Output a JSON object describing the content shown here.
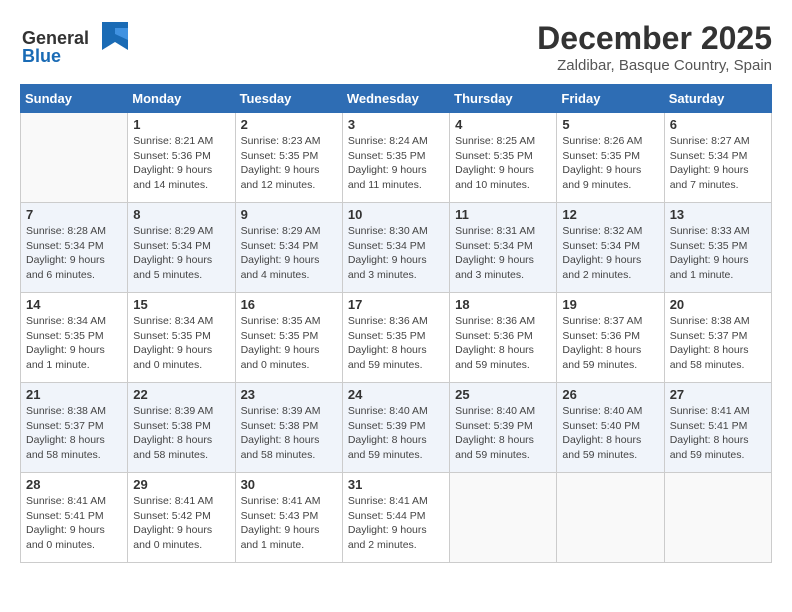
{
  "header": {
    "logo_general": "General",
    "logo_blue": "Blue",
    "month": "December 2025",
    "location": "Zaldibar, Basque Country, Spain"
  },
  "days_of_week": [
    "Sunday",
    "Monday",
    "Tuesday",
    "Wednesday",
    "Thursday",
    "Friday",
    "Saturday"
  ],
  "weeks": [
    [
      {
        "day": "",
        "info": ""
      },
      {
        "day": "1",
        "info": "Sunrise: 8:21 AM\nSunset: 5:36 PM\nDaylight: 9 hours\nand 14 minutes."
      },
      {
        "day": "2",
        "info": "Sunrise: 8:23 AM\nSunset: 5:35 PM\nDaylight: 9 hours\nand 12 minutes."
      },
      {
        "day": "3",
        "info": "Sunrise: 8:24 AM\nSunset: 5:35 PM\nDaylight: 9 hours\nand 11 minutes."
      },
      {
        "day": "4",
        "info": "Sunrise: 8:25 AM\nSunset: 5:35 PM\nDaylight: 9 hours\nand 10 minutes."
      },
      {
        "day": "5",
        "info": "Sunrise: 8:26 AM\nSunset: 5:35 PM\nDaylight: 9 hours\nand 9 minutes."
      },
      {
        "day": "6",
        "info": "Sunrise: 8:27 AM\nSunset: 5:34 PM\nDaylight: 9 hours\nand 7 minutes."
      }
    ],
    [
      {
        "day": "7",
        "info": "Sunrise: 8:28 AM\nSunset: 5:34 PM\nDaylight: 9 hours\nand 6 minutes."
      },
      {
        "day": "8",
        "info": "Sunrise: 8:29 AM\nSunset: 5:34 PM\nDaylight: 9 hours\nand 5 minutes."
      },
      {
        "day": "9",
        "info": "Sunrise: 8:29 AM\nSunset: 5:34 PM\nDaylight: 9 hours\nand 4 minutes."
      },
      {
        "day": "10",
        "info": "Sunrise: 8:30 AM\nSunset: 5:34 PM\nDaylight: 9 hours\nand 3 minutes."
      },
      {
        "day": "11",
        "info": "Sunrise: 8:31 AM\nSunset: 5:34 PM\nDaylight: 9 hours\nand 3 minutes."
      },
      {
        "day": "12",
        "info": "Sunrise: 8:32 AM\nSunset: 5:34 PM\nDaylight: 9 hours\nand 2 minutes."
      },
      {
        "day": "13",
        "info": "Sunrise: 8:33 AM\nSunset: 5:35 PM\nDaylight: 9 hours\nand 1 minute."
      }
    ],
    [
      {
        "day": "14",
        "info": "Sunrise: 8:34 AM\nSunset: 5:35 PM\nDaylight: 9 hours\nand 1 minute."
      },
      {
        "day": "15",
        "info": "Sunrise: 8:34 AM\nSunset: 5:35 PM\nDaylight: 9 hours\nand 0 minutes."
      },
      {
        "day": "16",
        "info": "Sunrise: 8:35 AM\nSunset: 5:35 PM\nDaylight: 9 hours\nand 0 minutes."
      },
      {
        "day": "17",
        "info": "Sunrise: 8:36 AM\nSunset: 5:35 PM\nDaylight: 8 hours\nand 59 minutes."
      },
      {
        "day": "18",
        "info": "Sunrise: 8:36 AM\nSunset: 5:36 PM\nDaylight: 8 hours\nand 59 minutes."
      },
      {
        "day": "19",
        "info": "Sunrise: 8:37 AM\nSunset: 5:36 PM\nDaylight: 8 hours\nand 59 minutes."
      },
      {
        "day": "20",
        "info": "Sunrise: 8:38 AM\nSunset: 5:37 PM\nDaylight: 8 hours\nand 58 minutes."
      }
    ],
    [
      {
        "day": "21",
        "info": "Sunrise: 8:38 AM\nSunset: 5:37 PM\nDaylight: 8 hours\nand 58 minutes."
      },
      {
        "day": "22",
        "info": "Sunrise: 8:39 AM\nSunset: 5:38 PM\nDaylight: 8 hours\nand 58 minutes."
      },
      {
        "day": "23",
        "info": "Sunrise: 8:39 AM\nSunset: 5:38 PM\nDaylight: 8 hours\nand 58 minutes."
      },
      {
        "day": "24",
        "info": "Sunrise: 8:40 AM\nSunset: 5:39 PM\nDaylight: 8 hours\nand 59 minutes."
      },
      {
        "day": "25",
        "info": "Sunrise: 8:40 AM\nSunset: 5:39 PM\nDaylight: 8 hours\nand 59 minutes."
      },
      {
        "day": "26",
        "info": "Sunrise: 8:40 AM\nSunset: 5:40 PM\nDaylight: 8 hours\nand 59 minutes."
      },
      {
        "day": "27",
        "info": "Sunrise: 8:41 AM\nSunset: 5:41 PM\nDaylight: 8 hours\nand 59 minutes."
      }
    ],
    [
      {
        "day": "28",
        "info": "Sunrise: 8:41 AM\nSunset: 5:41 PM\nDaylight: 9 hours\nand 0 minutes."
      },
      {
        "day": "29",
        "info": "Sunrise: 8:41 AM\nSunset: 5:42 PM\nDaylight: 9 hours\nand 0 minutes."
      },
      {
        "day": "30",
        "info": "Sunrise: 8:41 AM\nSunset: 5:43 PM\nDaylight: 9 hours\nand 1 minute."
      },
      {
        "day": "31",
        "info": "Sunrise: 8:41 AM\nSunset: 5:44 PM\nDaylight: 9 hours\nand 2 minutes."
      },
      {
        "day": "",
        "info": ""
      },
      {
        "day": "",
        "info": ""
      },
      {
        "day": "",
        "info": ""
      }
    ]
  ]
}
